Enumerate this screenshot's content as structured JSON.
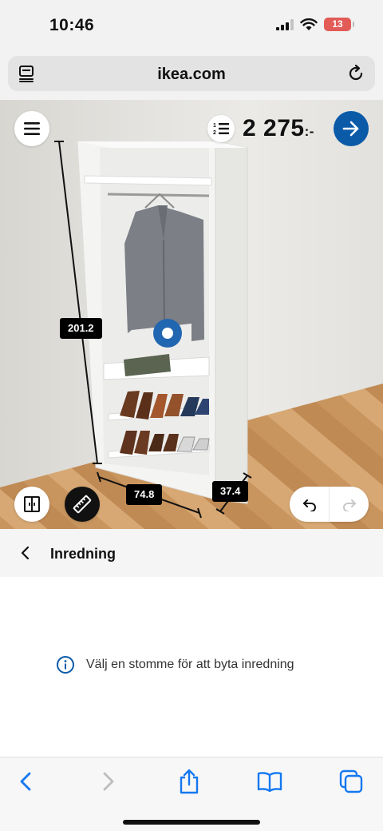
{
  "status_bar": {
    "time": "10:46",
    "battery_level": "13",
    "icons": [
      "signal-icon",
      "wifi-icon",
      "battery-icon"
    ]
  },
  "browser": {
    "url": "ikea.com"
  },
  "planner": {
    "price": "2 275",
    "price_suffix": ":-",
    "dimensions": {
      "height": "201.2",
      "width": "74.8",
      "depth": "37.4"
    },
    "colors": {
      "accent": "#0a5aa8",
      "selection": "#2166b1"
    }
  },
  "panel": {
    "title": "Inredning",
    "info_message": "Välj en stomme för att byta inredning"
  },
  "toolbar": {
    "icons": [
      "back-icon",
      "forward-icon",
      "share-icon",
      "bookmarks-icon",
      "tabs-icon"
    ]
  }
}
